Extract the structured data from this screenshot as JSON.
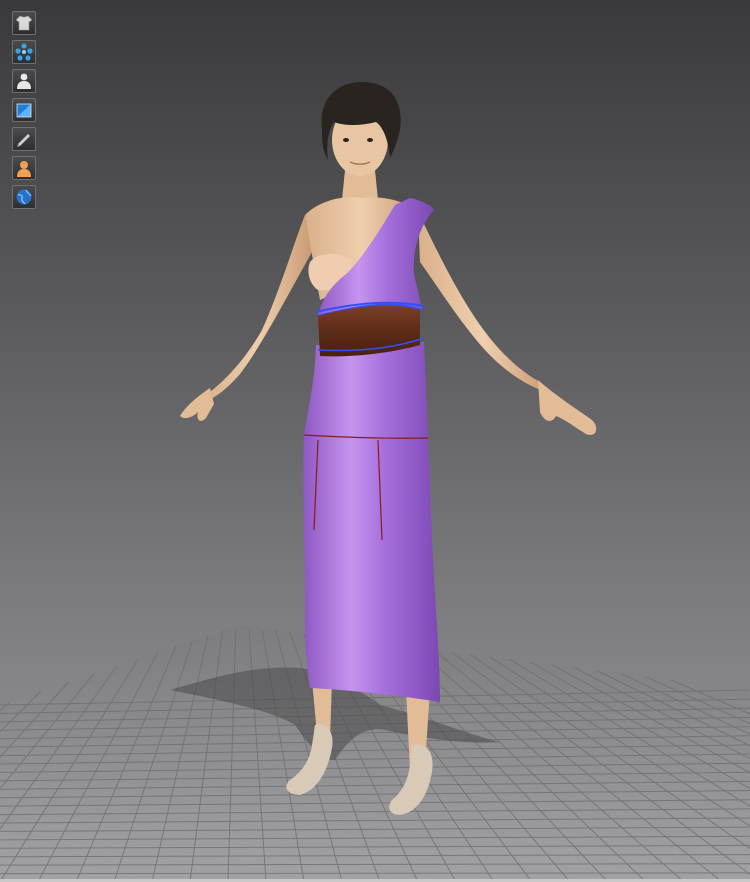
{
  "window": {
    "title": ""
  },
  "toolbar": {
    "items": [
      {
        "name": "show-garment",
        "icon": "shirt-icon"
      },
      {
        "name": "show-points",
        "icon": "points-icon"
      },
      {
        "name": "show-avatar",
        "icon": "avatar-icon"
      },
      {
        "name": "show-texture",
        "icon": "texture-icon"
      },
      {
        "name": "show-shade",
        "icon": "shade-icon"
      },
      {
        "name": "show-skin",
        "icon": "skin-icon"
      },
      {
        "name": "show-environment",
        "icon": "globe-icon"
      }
    ]
  },
  "scene": {
    "background": "#5a5a5c",
    "floor_grid": "#8a8a8a",
    "dress_color": "#b07be0",
    "belt_color": "#6b3320",
    "selection_outline": "#3050ff",
    "seam_color": "#8a1a1a",
    "skin_color": "#e8c39c",
    "hair_color": "#2a2420",
    "shoe_color": "#d6c8b4"
  }
}
